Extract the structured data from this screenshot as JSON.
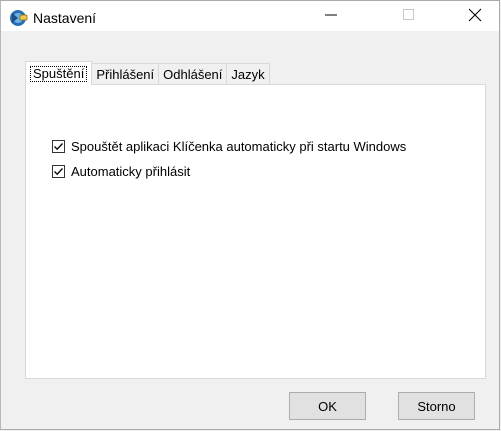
{
  "window": {
    "title": "Nastavení",
    "icon": "keychain-app-icon"
  },
  "titlebar_buttons": [
    "minimize-icon",
    "maximize-icon",
    "close-icon"
  ],
  "tabs": [
    {
      "label": "Spuštění",
      "active": true
    },
    {
      "label": "Přihlášení",
      "active": false
    },
    {
      "label": "Odhlášení",
      "active": false
    },
    {
      "label": "Jazyk",
      "active": false
    }
  ],
  "options": [
    {
      "label": "Spouštět aplikaci Klíčenka automaticky při startu Windows",
      "checked": true
    },
    {
      "label": "Automaticky přihlásit",
      "checked": true
    }
  ],
  "buttons": {
    "ok": "OK",
    "cancel": "Storno"
  }
}
